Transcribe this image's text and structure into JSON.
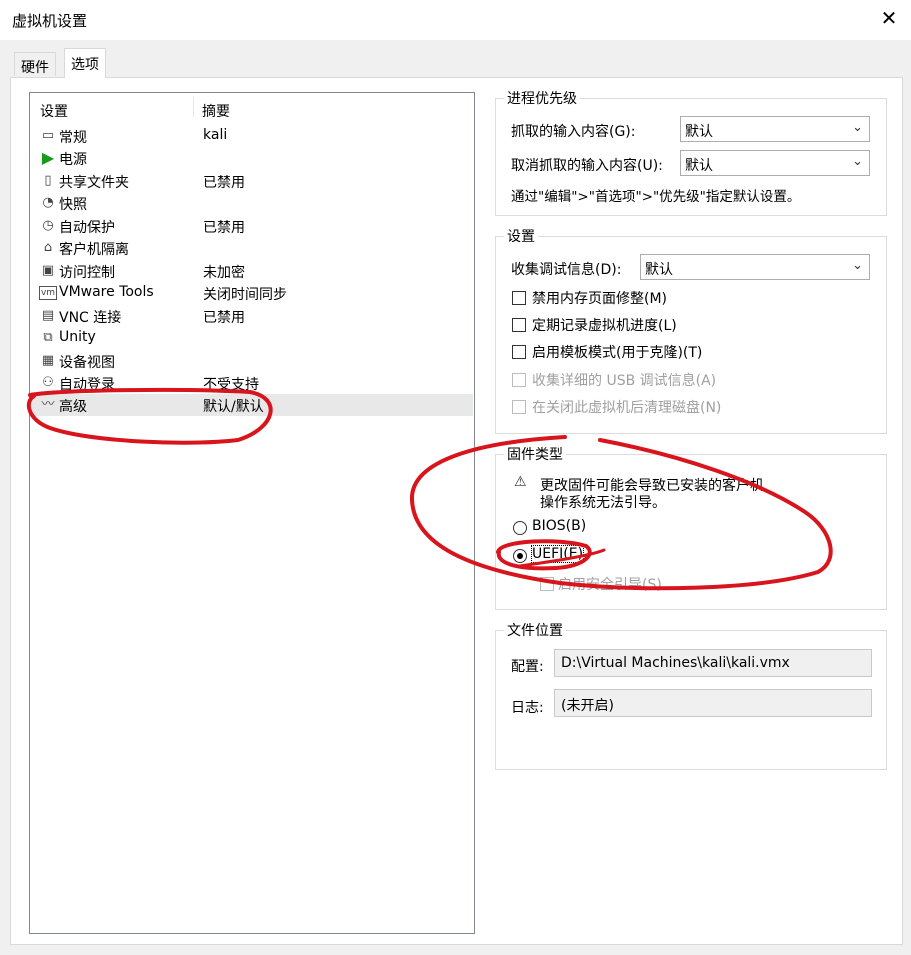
{
  "window": {
    "title": "虚拟机设置",
    "close_glyph": "✕"
  },
  "tabs": [
    {
      "label": "硬件"
    },
    {
      "label": "选项"
    }
  ],
  "list": {
    "headers": {
      "setting": "设置",
      "summary": "摘要"
    },
    "items": [
      {
        "icon": "monitor-icon",
        "glyph": "▭",
        "name": "常规",
        "summary": "kali"
      },
      {
        "icon": "power-icon",
        "glyph": "▶",
        "name": "电源",
        "summary": ""
      },
      {
        "icon": "shared-folder-icon",
        "glyph": "▯",
        "name": "共享文件夹",
        "summary": "已禁用"
      },
      {
        "icon": "snapshot-icon",
        "glyph": "◔",
        "name": "快照",
        "summary": ""
      },
      {
        "icon": "autoprotect-icon",
        "glyph": "◷",
        "name": "自动保护",
        "summary": "已禁用"
      },
      {
        "icon": "lock-icon",
        "glyph": "⌂",
        "name": "客户机隔离",
        "summary": ""
      },
      {
        "icon": "access-control-icon",
        "glyph": "▣",
        "name": "访问控制",
        "summary": "未加密"
      },
      {
        "icon": "vmware-tools-icon",
        "glyph": "vm",
        "name": "VMware Tools",
        "summary": "关闭时间同步"
      },
      {
        "icon": "vnc-icon",
        "glyph": "▤",
        "name": "VNC 连接",
        "summary": "已禁用"
      },
      {
        "icon": "unity-icon",
        "glyph": "⧉",
        "name": "Unity",
        "summary": ""
      },
      {
        "icon": "device-view-icon",
        "glyph": "▦",
        "name": "设备视图",
        "summary": ""
      },
      {
        "icon": "autologin-icon",
        "glyph": "⚇",
        "name": "自动登录",
        "summary": "不受支持"
      },
      {
        "icon": "advanced-icon",
        "glyph": "〰",
        "name": "高级",
        "summary": "默认/默认"
      }
    ]
  },
  "priority": {
    "title": "进程优先级",
    "grabbed_label": "抓取的输入内容(G):",
    "grabbed_value": "默认",
    "ungrabbed_label": "取消抓取的输入内容(U):",
    "ungrabbed_value": "默认",
    "hint": "通过\"编辑\">\"首选项\">\"优先级\"指定默认设置。"
  },
  "settings": {
    "title": "设置",
    "debug_label": "收集调试信息(D):",
    "debug_value": "默认",
    "checkboxes": [
      {
        "label": "禁用内存页面修整(M)"
      },
      {
        "label": "定期记录虚拟机进度(L)"
      },
      {
        "label": "启用模板模式(用于克隆)(T)"
      },
      {
        "label": "收集详细的 USB 调试信息(A)"
      },
      {
        "label": "在关闭此虚拟机后清理磁盘(N)"
      }
    ]
  },
  "firmware": {
    "title": "固件类型",
    "warning_line1": "更改固件可能会导致已安装的客户机",
    "warning_line2": "操作系统无法引导。",
    "bios_label": "BIOS(B)",
    "uefi_label": "UEFI(E)",
    "secure_boot_label": "启用安全引导(S)",
    "selected": "UEFI(E)"
  },
  "file_location": {
    "title": "文件位置",
    "config_label": "配置:",
    "config_value": "D:\\Virtual Machines\\kali\\kali.vmx",
    "log_label": "日志:",
    "log_value": "(未开启)"
  },
  "colors": {
    "annotation": "#d8141c",
    "power_green": "#1a9a1a"
  }
}
